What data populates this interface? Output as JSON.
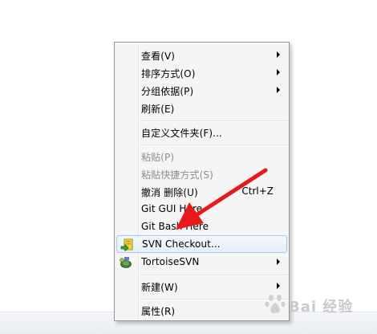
{
  "context_menu": {
    "items": [
      {
        "label": "查看(V)",
        "submenu": true
      },
      {
        "label": "排序方式(O)",
        "submenu": true
      },
      {
        "label": "分组依据(P)",
        "submenu": true
      },
      {
        "label": "刷新(E)"
      },
      {
        "label": "自定义文件夹(F)..."
      },
      {
        "label": "粘贴(P)",
        "disabled": true
      },
      {
        "label": "粘贴快捷方式(S)",
        "disabled": true
      },
      {
        "label": "撤消 删除(U)",
        "shortcut": "Ctrl+Z"
      },
      {
        "label": "Git GUI Here"
      },
      {
        "label": "Git Bash Here"
      },
      {
        "label": "SVN Checkout...",
        "icon": "svn-checkout-icon",
        "highlighted": true
      },
      {
        "label": "TortoiseSVN",
        "icon": "tortoisesvn-icon",
        "submenu": true
      },
      {
        "label": "新建(W)",
        "submenu": true
      },
      {
        "label": "属性(R)"
      }
    ]
  },
  "annotation": {
    "color": "#e8191b",
    "icon": "red-pointer-arrow"
  },
  "watermark": {
    "text": "Bai 经验"
  }
}
